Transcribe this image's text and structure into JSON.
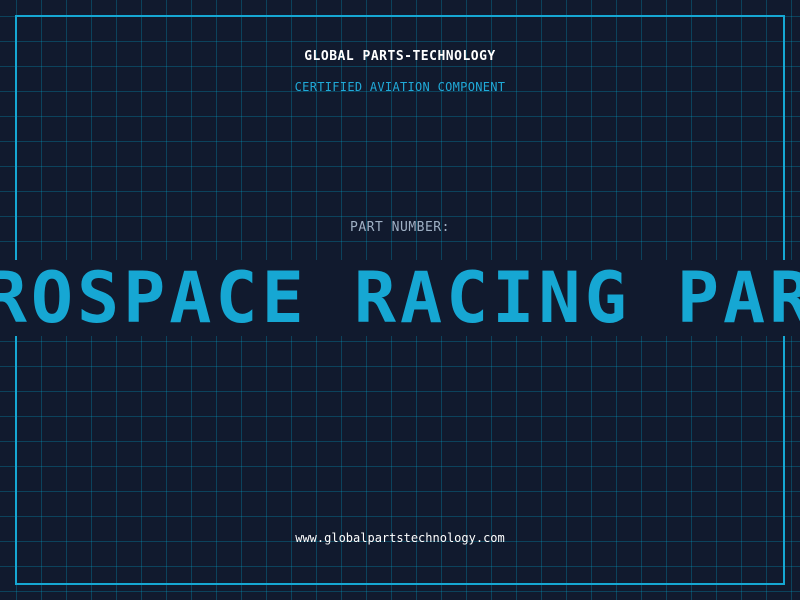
{
  "header": {
    "company": "GLOBAL PARTS-TECHNOLOGY",
    "subtitle": "CERTIFIED AVIATION COMPONENT"
  },
  "part": {
    "label": "PART NUMBER:",
    "number": "AEROSPACE RACING PARTS"
  },
  "footer": {
    "website": "www.globalpartstechnology.com"
  },
  "colors": {
    "background": "#111a2e",
    "accent": "#16a7d3",
    "grid": "#0f4a63",
    "label": "#9fb0c4"
  }
}
